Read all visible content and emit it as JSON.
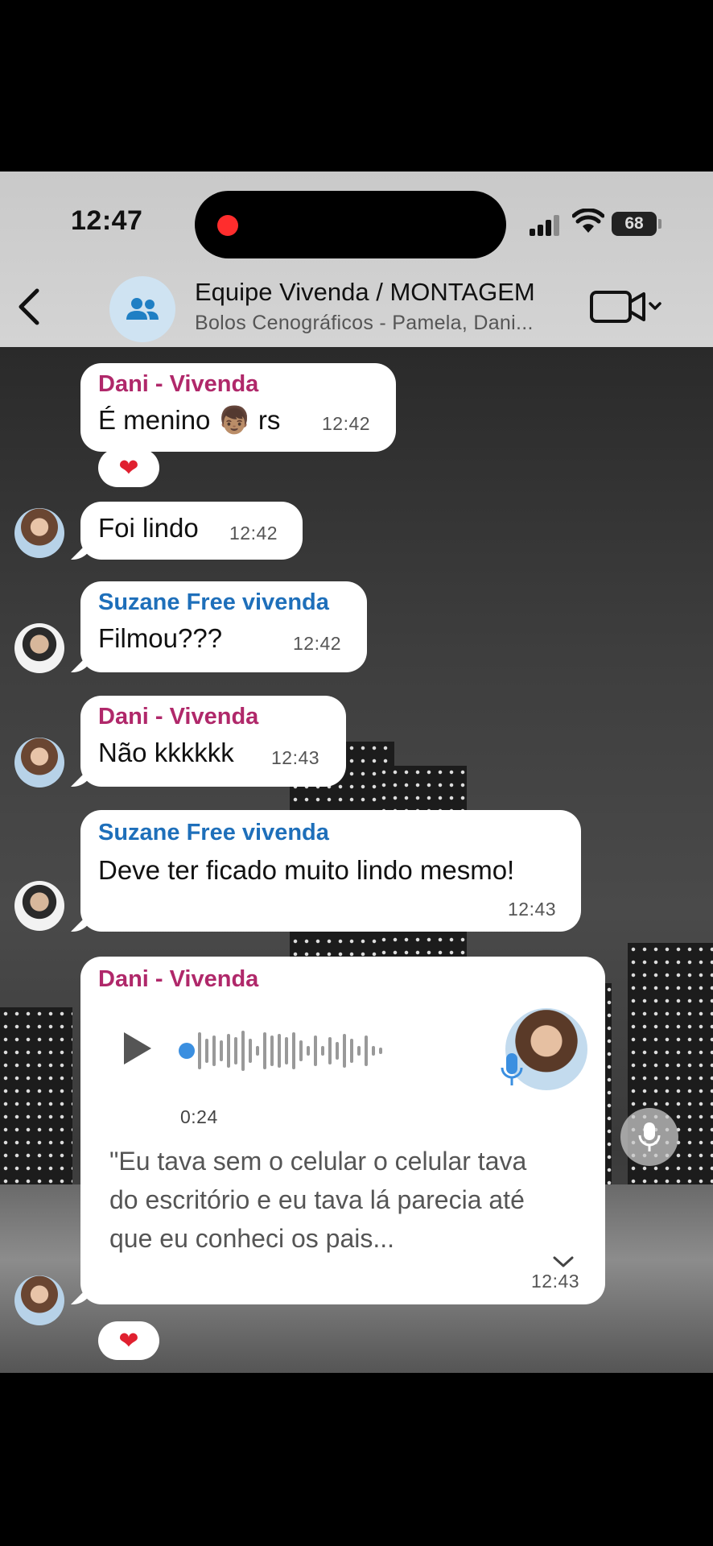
{
  "status_bar": {
    "time": "12:47",
    "battery": "68"
  },
  "header": {
    "title": "Equipe Vivenda / MONTAGEM",
    "subtitle": "Bolos Cenográficos - Pamela, Dani..."
  },
  "messages": [
    {
      "sender": "Dani - Vivenda",
      "text": "É menino 👦🏽 rs",
      "time": "12:42",
      "reaction": "❤"
    },
    {
      "text": "Foi lindo",
      "time": "12:42"
    },
    {
      "sender": "Suzane Free vivenda",
      "text": "Filmou???",
      "time": "12:42"
    },
    {
      "sender": "Dani - Vivenda",
      "text": "Não kkkkkk",
      "time": "12:43"
    },
    {
      "sender": "Suzane Free vivenda",
      "text": "Deve ter ficado muito lindo mesmo!",
      "time": "12:43"
    }
  ],
  "voice_message": {
    "sender": "Dani - Vivenda",
    "duration": "0:24",
    "transcript": "\"Eu tava sem o celular o celular tava do escritório e eu tava lá parecia até que eu conheci os pais...",
    "time": "12:43",
    "reaction": "❤"
  },
  "colors": {
    "sender_pink": "#b0286a",
    "sender_blue": "#1e6fba",
    "header_bg": "#cfcfcf",
    "group_avatar": "#cfe3f2"
  },
  "icons": [
    "back-chevron-icon",
    "group-icon",
    "video-call-icon",
    "play-icon",
    "microphone-icon",
    "chevron-down-icon",
    "heart-icon"
  ]
}
